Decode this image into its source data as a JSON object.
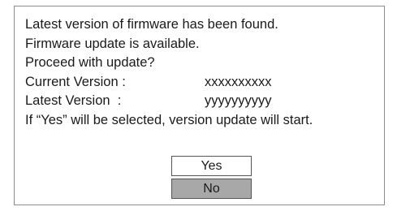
{
  "dialog": {
    "lines": [
      "Latest version of firmware has been found.",
      "Firmware update is available.",
      "Proceed with update?"
    ],
    "current_version_label": "Current Version :",
    "current_version_value": "xxxxxxxxxx",
    "latest_version_label": "Latest Version  :",
    "latest_version_value": "yyyyyyyyyy",
    "note": "If “Yes” will be selected, version update will start.",
    "yes_label": "Yes",
    "no_label": "No"
  },
  "colors": {
    "border": "#8c8c8c",
    "selected_button": "#a8a8a8",
    "text": "#1a1a1a"
  }
}
